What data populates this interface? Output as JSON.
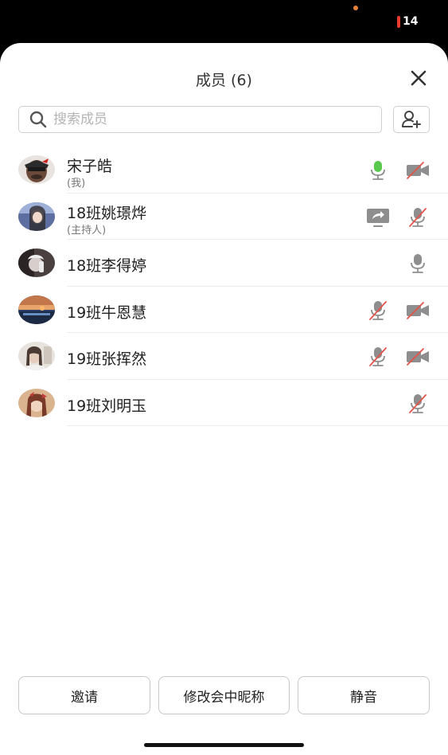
{
  "status": {
    "battery": "14"
  },
  "header": {
    "title": "成员 (6)"
  },
  "search": {
    "placeholder": "搜索成员"
  },
  "members": [
    {
      "name": "宋子皓",
      "sub": "(我)",
      "icons": [
        "mic-active-icon",
        "camera-off-icon"
      ]
    },
    {
      "name": "18班姚璟烨",
      "sub": "(主持人)",
      "icons": [
        "screen-share-icon",
        "mic-muted-icon"
      ]
    },
    {
      "name": "18班李得婷",
      "sub": "",
      "icons": [
        "mic-icon"
      ]
    },
    {
      "name": "19班牛恩慧",
      "sub": "",
      "icons": [
        "mic-muted-icon",
        "camera-off-icon"
      ]
    },
    {
      "name": "19班张挥然",
      "sub": "",
      "icons": [
        "mic-muted-icon",
        "camera-off-icon"
      ]
    },
    {
      "name": "19班刘明玉",
      "sub": "",
      "icons": [
        "mic-muted-icon"
      ]
    }
  ],
  "actions": {
    "invite": "邀请",
    "rename": "修改会中昵称",
    "mute": "静音"
  },
  "colors": {
    "mic_active": "#5ac84c",
    "muted_slash": "#e5534b",
    "icon_gray": "#8e8e8e"
  }
}
